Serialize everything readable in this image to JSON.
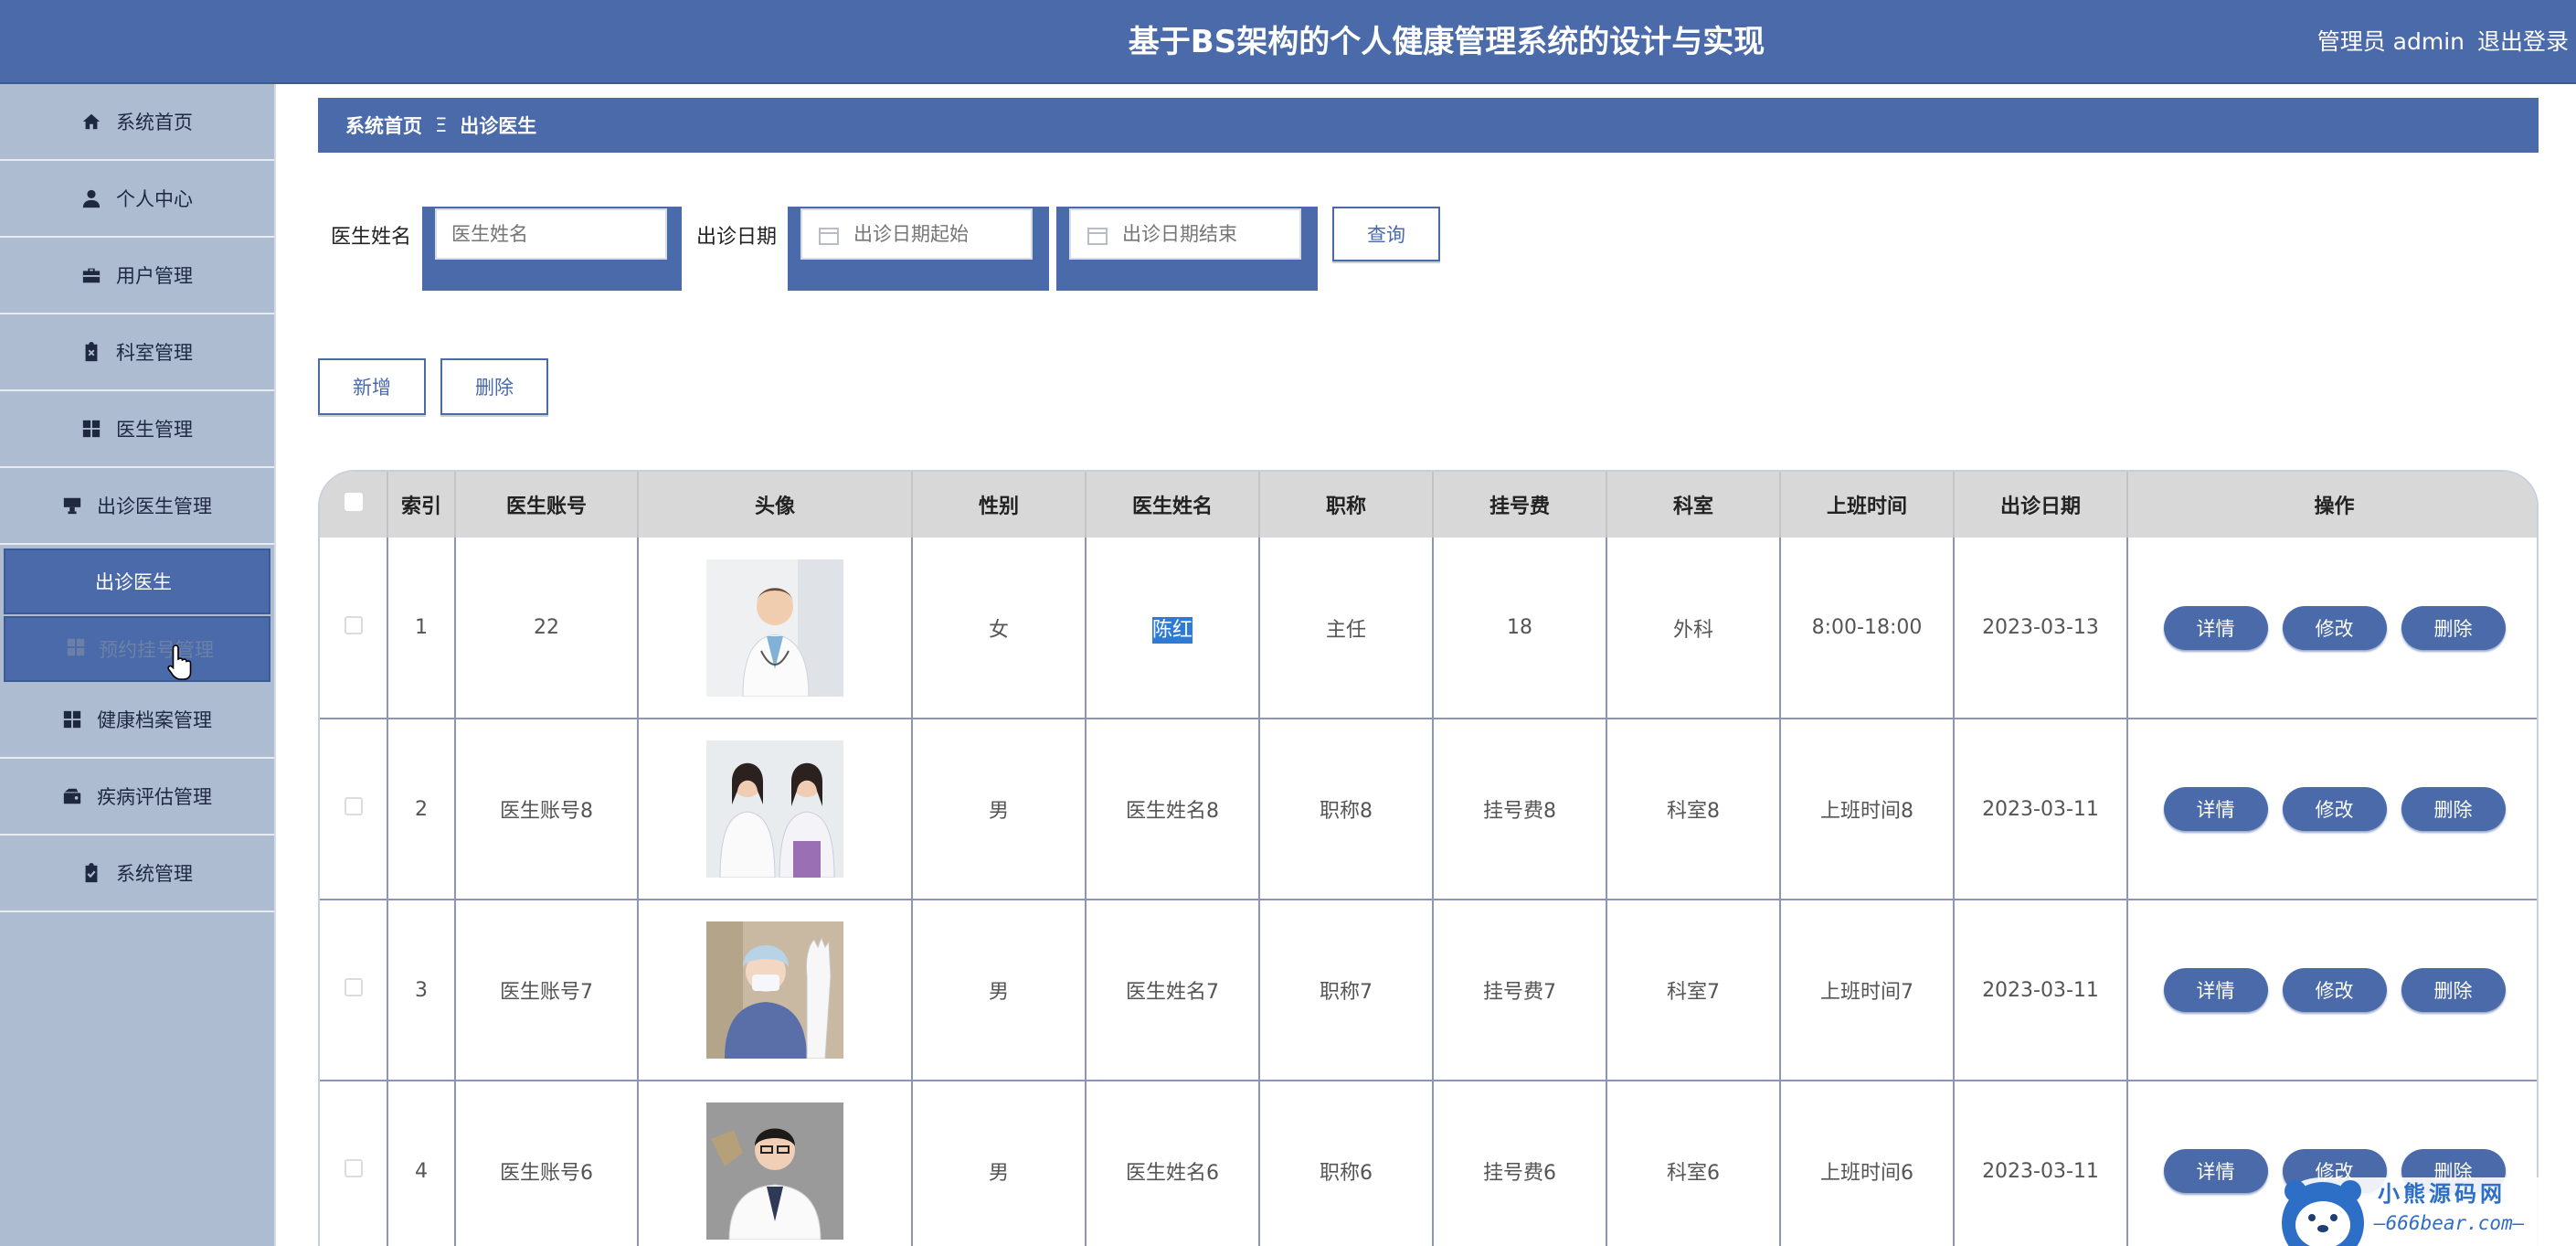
{
  "header": {
    "title": "基于BS架构的个人健康管理系统的设计与实现",
    "user_label": "管理员 admin",
    "logout_label": "退出登录"
  },
  "sidebar": {
    "items": [
      {
        "label": "系统首页",
        "icon": "home-icon"
      },
      {
        "label": "个人中心",
        "icon": "person-icon"
      },
      {
        "label": "用户管理",
        "icon": "briefcase-icon"
      },
      {
        "label": "科室管理",
        "icon": "clipboard-x-icon"
      },
      {
        "label": "医生管理",
        "icon": "grid-icon"
      },
      {
        "label": "出诊医生管理",
        "icon": "monitor-icon"
      }
    ],
    "submenu_active": "出诊医生",
    "submenu_hover": "预约挂号管理",
    "items_after": [
      {
        "label": "健康档案管理",
        "icon": "grid-icon"
      },
      {
        "label": "疾病评估管理",
        "icon": "wallet-icon"
      },
      {
        "label": "系统管理",
        "icon": "clipboard-check-icon"
      }
    ]
  },
  "breadcrumb": {
    "home": "系统首页",
    "separator": "Ξ",
    "current": "出诊医生"
  },
  "search": {
    "name_label": "医生姓名",
    "name_placeholder": "医生姓名",
    "date_label": "出诊日期",
    "date_start_placeholder": "出诊日期起始",
    "date_end_placeholder": "出诊日期结束",
    "query_label": "查询"
  },
  "actions": {
    "add_label": "新增",
    "delete_label": "删除"
  },
  "table": {
    "headers": [
      "",
      "索引",
      "医生账号",
      "头像",
      "性别",
      "医生姓名",
      "职称",
      "挂号费",
      "科室",
      "上班时间",
      "出诊日期",
      "操作"
    ],
    "rows": [
      {
        "index": "1",
        "account": "22",
        "gender": "女",
        "name": "陈红",
        "title": "主任",
        "fee": "18",
        "dept": "外科",
        "work_time": "8:00-18:00",
        "date": "2023-03-13"
      },
      {
        "index": "2",
        "account": "医生账号8",
        "gender": "男",
        "name": "医生姓名8",
        "title": "职称8",
        "fee": "挂号费8",
        "dept": "科室8",
        "work_time": "上班时间8",
        "date": "2023-03-11"
      },
      {
        "index": "3",
        "account": "医生账号7",
        "gender": "男",
        "name": "医生姓名7",
        "title": "职称7",
        "fee": "挂号费7",
        "dept": "科室7",
        "work_time": "上班时间7",
        "date": "2023-03-11"
      },
      {
        "index": "4",
        "account": "医生账号6",
        "gender": "男",
        "name": "医生姓名6",
        "title": "职称6",
        "fee": "挂号费6",
        "dept": "科室6",
        "work_time": "上班时间6",
        "date": "2023-03-11"
      }
    ],
    "op_labels": {
      "detail": "详情",
      "edit": "修改",
      "delete": "删除"
    }
  },
  "watermark": {
    "name": "小熊源码网",
    "url": "—666bear.com—"
  },
  "colors": {
    "primary": "#4a6aa9",
    "sidebar_bg": "#aebcd2",
    "header_row": "#d8d8d8",
    "highlight": "#2e7bd6"
  }
}
